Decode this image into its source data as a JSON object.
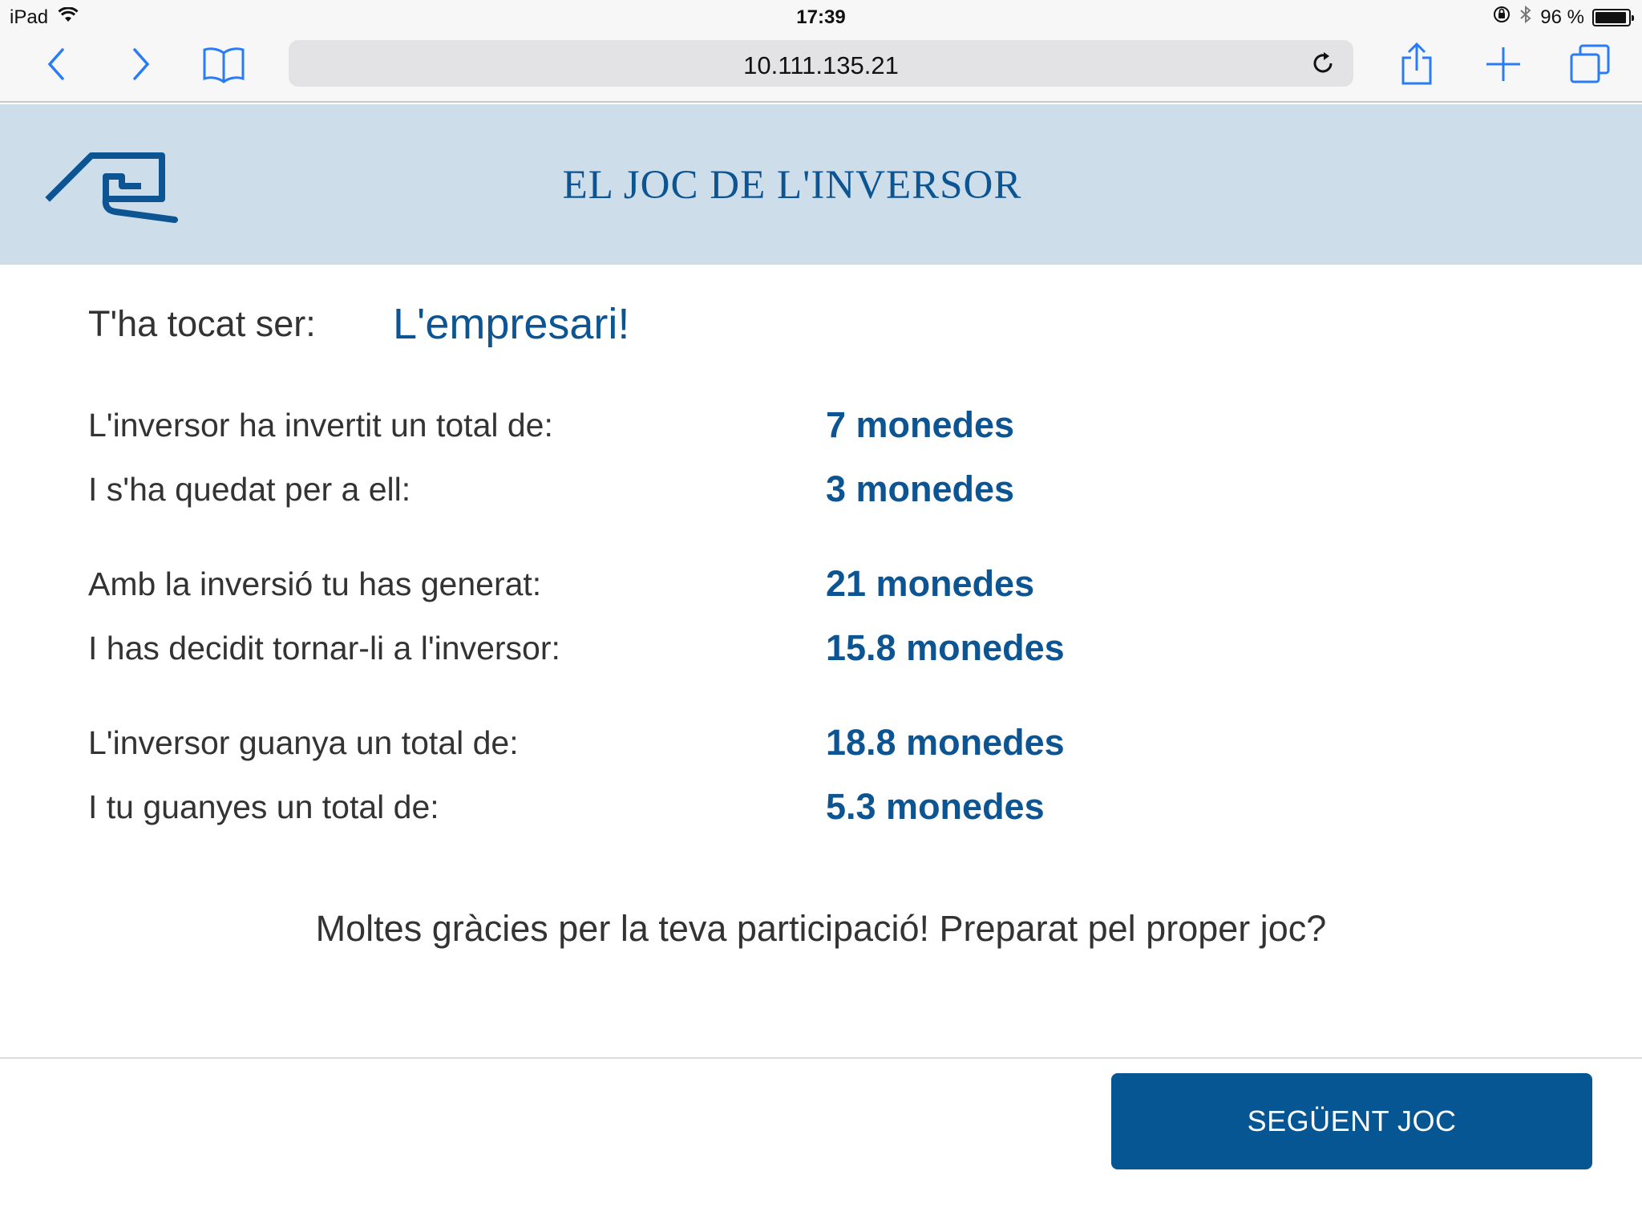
{
  "status_bar": {
    "device": "iPad",
    "time": "17:39",
    "battery": "96 %",
    "battery_level": 0.96
  },
  "browser": {
    "url": "10.111.135.21",
    "accent_color": "#2a7cf6"
  },
  "header": {
    "title": "EL JOC DE L'INVERSOR",
    "background_color": "#cddde9",
    "brand_color": "#0d5592"
  },
  "role": {
    "label": "T'ha tocat ser:",
    "value": "L'empresari!"
  },
  "results": [
    [
      {
        "label": "L'inversor ha invertit un total de:",
        "value": "7 monedes"
      },
      {
        "label": "I s'ha quedat per a ell:",
        "value": "3 monedes"
      }
    ],
    [
      {
        "label": "Amb la inversió tu has generat:",
        "value": "21 monedes"
      },
      {
        "label": "I has decidit tornar-li a l'inversor:",
        "value": "15.8 monedes"
      }
    ],
    [
      {
        "label": "L'inversor guanya un total de:",
        "value": "18.8 monedes"
      },
      {
        "label": "I tu guanyes un total de:",
        "value": "5.3 monedes"
      }
    ]
  ],
  "footer": {
    "thanks": "Moltes gràcies per la teva participació! Preparat pel proper joc?",
    "next_button": "SEGÜENT JOC",
    "button_color": "#065694"
  },
  "icons": {
    "back": "chevron-left-icon",
    "forward": "chevron-right-icon",
    "bookmarks": "book-icon",
    "reload": "reload-icon",
    "share": "share-icon",
    "new_tab": "plus-icon",
    "tabs": "tabs-icon",
    "wifi": "wifi-icon",
    "lock_rotation": "rotation-lock-icon",
    "bluetooth": "bluetooth-icon",
    "logo": "logo-icon"
  }
}
